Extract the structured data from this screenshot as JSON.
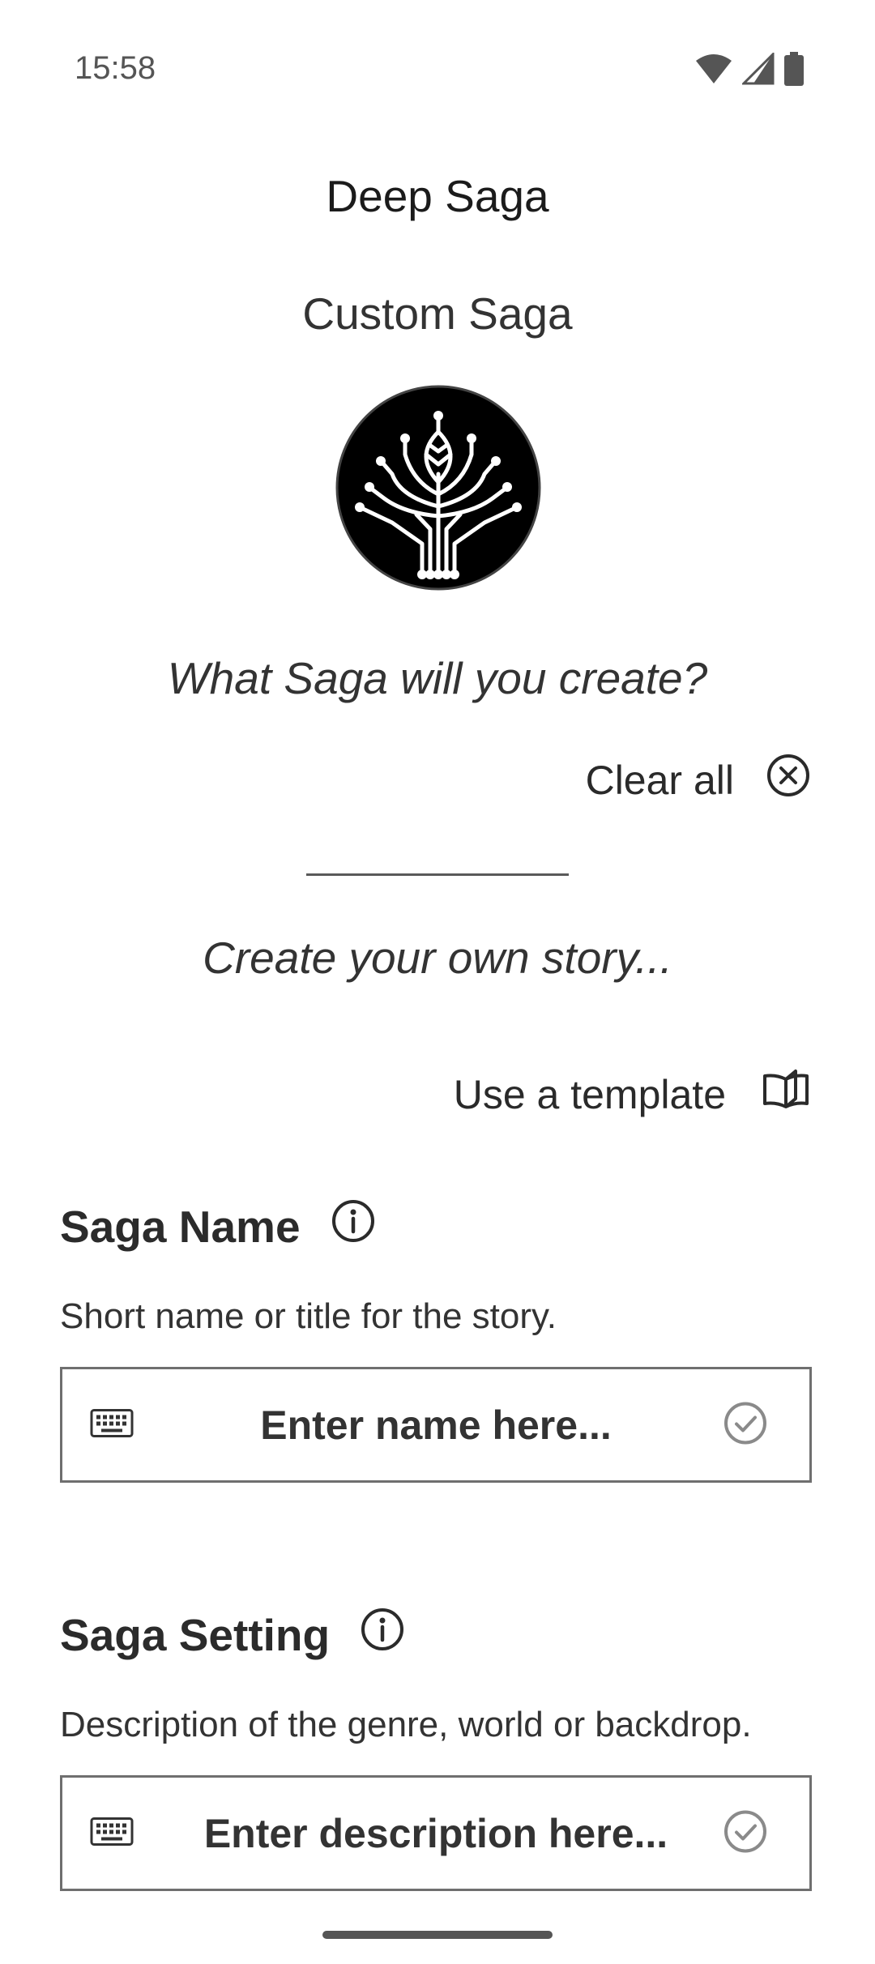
{
  "status_bar": {
    "time": "15:58",
    "icons": [
      "wifi-icon",
      "signal-icon",
      "battery-icon"
    ]
  },
  "header": {
    "app_title": "Deep Saga",
    "subtitle": "Custom Saga",
    "logo_icon": "circuit-tree-logo"
  },
  "intro": {
    "prompt": "What Saga will you create?",
    "clear_all_label": "Clear all",
    "story_line": "Create your own story...",
    "use_template_label": "Use a template"
  },
  "saga_name": {
    "title": "Saga Name",
    "description": "Short name or title for the story.",
    "placeholder": "Enter name here...",
    "value": ""
  },
  "saga_setting": {
    "title": "Saga Setting",
    "description": "Description of the genre, world or backdrop.",
    "placeholder": "Enter description here...",
    "value": ""
  },
  "colors": {
    "text": "#212121",
    "muted": "#555555",
    "border": "#6f6f6f",
    "icon_gray": "#8a8a8a",
    "logo_bg": "#000000"
  }
}
